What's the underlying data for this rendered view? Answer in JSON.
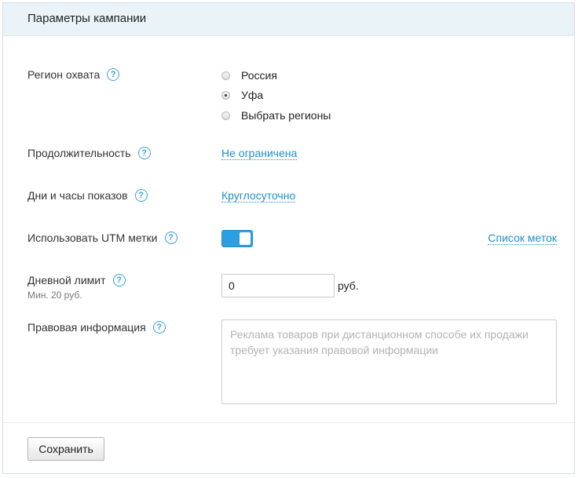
{
  "header": {
    "title": "Параметры кампании"
  },
  "region": {
    "label": "Регион охвата",
    "options": [
      {
        "label": "Россия",
        "checked": false
      },
      {
        "label": "Уфа",
        "checked": true
      },
      {
        "label": "Выбрать регионы",
        "checked": false
      }
    ]
  },
  "duration": {
    "label": "Продолжительность",
    "value": "Не ограничена"
  },
  "schedule": {
    "label": "Дни и часы показов",
    "value": "Круглосуточно"
  },
  "utm": {
    "label": "Использовать UTM метки",
    "enabled": true,
    "list_link": "Список меток"
  },
  "daily_limit": {
    "label": "Дневной лимит",
    "hint": "Мин. 20 руб.",
    "value": "0",
    "currency": "руб."
  },
  "legal": {
    "label": "Правовая информация",
    "placeholder": "Реклама товаров при дистанционном способе их продажи требует указания правовой информации"
  },
  "help_icon_glyph": "?",
  "footer": {
    "save_label": "Сохранить"
  },
  "colors": {
    "accent": "#2c9fe0",
    "link": "#1f8fc9",
    "header_bg": "#eaf3f8"
  }
}
